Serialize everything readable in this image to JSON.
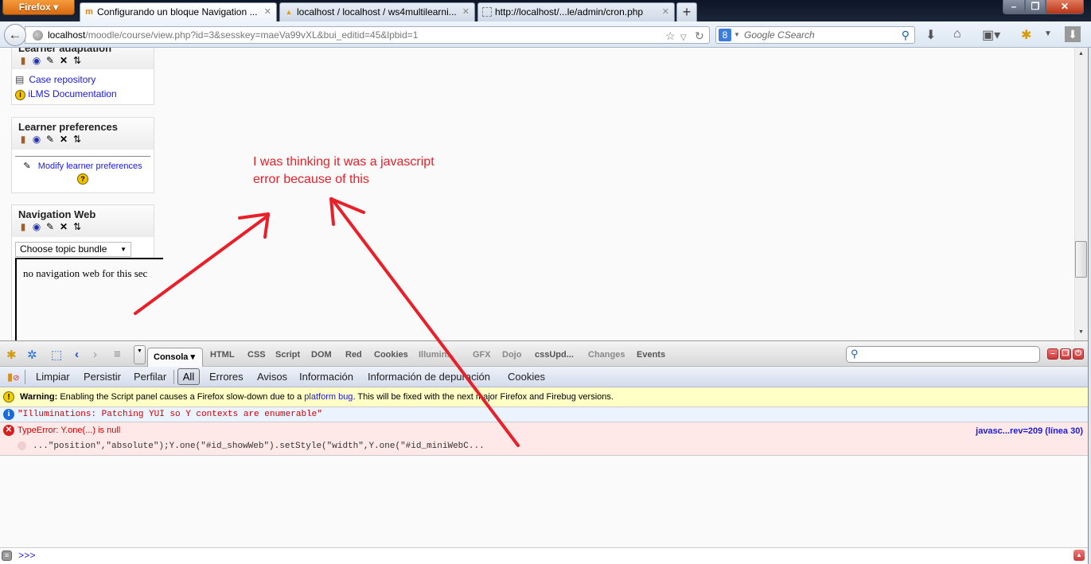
{
  "browser": {
    "menu_button": "Firefox",
    "tabs": [
      {
        "title": "Configurando un bloque Navigation ...",
        "icon": "moodle-icon",
        "active": true
      },
      {
        "title": "localhost / localhost / ws4multilearni...",
        "icon": "phpmyadmin-icon",
        "active": false
      },
      {
        "title": "http://localhost/...le/admin/cron.php",
        "icon": "blank-page-icon",
        "active": false
      }
    ],
    "new_tab": "+",
    "window_controls": {
      "minimize": "–",
      "restore": "❐",
      "close": "✕"
    },
    "url_host": "localhost",
    "url_path": "/moodle/course/view.php?id=3&sesskey=maeVa99vXL&bui_editid=45&lpbid=1",
    "search_placeholder": "Google CSearch",
    "search_engine_glyph": "8"
  },
  "page": {
    "blocks": [
      {
        "title": "Learner adaptation",
        "links": [
          {
            "icon": "repository-icon",
            "label": "Case repository"
          },
          {
            "icon": "info-icon",
            "label": "iLMS Documentation"
          }
        ]
      },
      {
        "title": "Learner preferences",
        "links": [
          {
            "icon": "edit-icon",
            "label": "Modify learner preferences"
          }
        ],
        "help_glyph": "?"
      },
      {
        "title": "Navigation Web",
        "select_value": "Choose topic bundle",
        "content_text": "no navigation web for this sec"
      }
    ],
    "edit_icons": [
      "move-icon",
      "hide-icon",
      "edit-icon",
      "delete-icon",
      "move-updown-icon"
    ]
  },
  "annotation": {
    "text": "I was thinking it was a javascript error because of this",
    "color": "#e8202a"
  },
  "firebug": {
    "panel_tabs": [
      {
        "label": "Consola ▾",
        "active": true
      },
      {
        "label": "HTML"
      },
      {
        "label": "CSS"
      },
      {
        "label": "Script"
      },
      {
        "label": "DOM"
      },
      {
        "label": "Red"
      },
      {
        "label": "Cookies"
      },
      {
        "label": "Illumin..."
      },
      {
        "label": "GFX"
      },
      {
        "label": "Dojo"
      },
      {
        "label": "cssUpd..."
      },
      {
        "label": "Changes"
      },
      {
        "label": "Events"
      }
    ],
    "console_toolbar": [
      "Limpiar",
      "Persistir",
      "Perfilar",
      "All",
      "Errores",
      "Avisos",
      "Información",
      "Información de depuración",
      "Cookies"
    ],
    "active_filter": "All",
    "messages": {
      "warning_label": "Warning:",
      "warning_text_1": "Enabling the Script panel causes a Firefox slow-down due to a",
      "warning_link": "platform bug",
      "warning_text_2": ". This will be fixed with the next major Firefox and Firebug versions.",
      "info_text": "\"Illuminations: Patching YUI so Y contexts are enumerable\"",
      "error_title": "TypeError: Y.one(...) is null",
      "error_source": "javasc...rev=209 (línea 30)",
      "error_code": "...\"position\",\"absolute\");Y.one(\"#id_showWeb\").setStyle(\"width\",Y.one(\"#id_miniWebC..."
    },
    "command_prompt": ">>>",
    "colors": {
      "warning_bg": "#ffffc6",
      "info_bg": "#ebf3ff",
      "error_bg": "#ffe8e8",
      "error_text": "#cc0000"
    }
  }
}
